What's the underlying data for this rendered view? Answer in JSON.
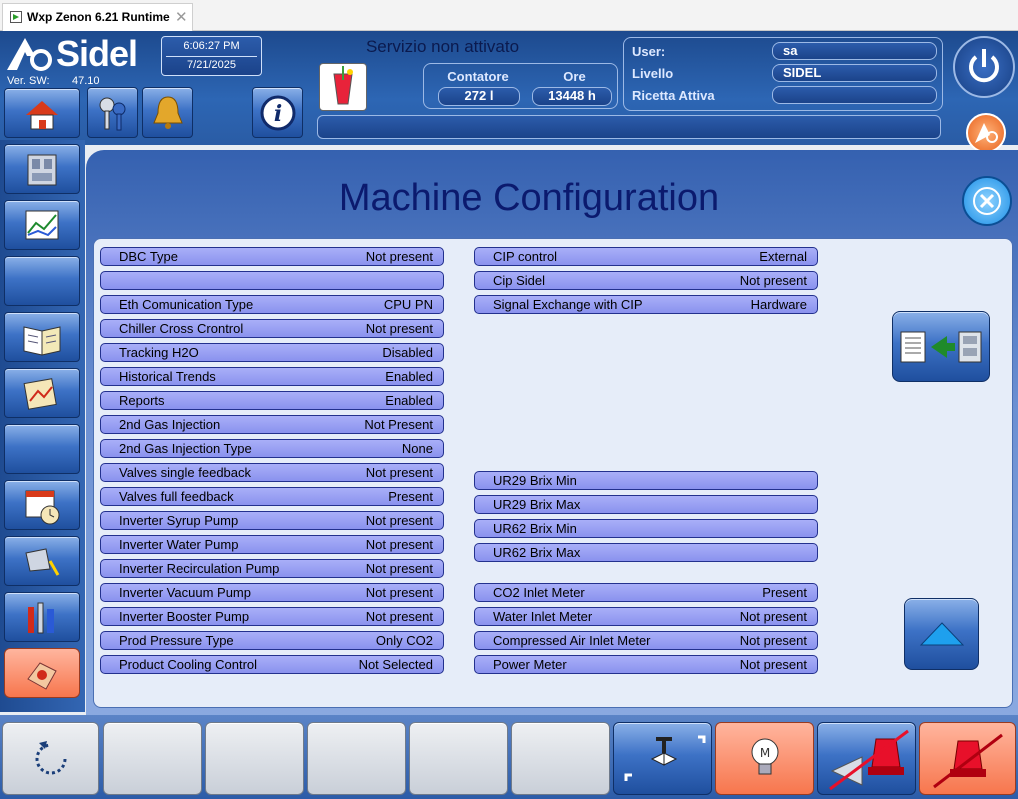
{
  "window": {
    "title": "Wxp Zenon 6.21 Runtime",
    "close": "✕"
  },
  "header": {
    "brand": "Sidel",
    "version_label": "Ver. SW:",
    "version_value": "47.10",
    "time": "6:06:27 PM",
    "date": "7/21/2025",
    "service_status": "Servizio non attivato",
    "counter_label": "Contatore",
    "counter_value": "272 l",
    "hours_label": "Ore",
    "hours_value": "13448 h",
    "user_label": "User:",
    "user_value": "sa",
    "level_label": "Livello",
    "level_value": "SIDEL",
    "recipe_label": "Ricetta Attiva",
    "recipe_value": ""
  },
  "page": {
    "title": "Machine Configuration"
  },
  "left_rows": [
    {
      "label": "DBC Type",
      "value": "Not present"
    },
    {
      "label": "",
      "value": ""
    },
    {
      "label": "Eth Comunication Type",
      "value": "CPU PN"
    },
    {
      "label": "Chiller Cross Crontrol",
      "value": "Not present"
    },
    {
      "label": "Tracking H2O",
      "value": "Disabled"
    },
    {
      "label": "Historical Trends",
      "value": "Enabled"
    },
    {
      "label": "Reports",
      "value": "Enabled"
    },
    {
      "label": "2nd Gas Injection",
      "value": "Not Present"
    },
    {
      "label": "2nd Gas Injection Type",
      "value": "None"
    },
    {
      "label": "Valves single feedback",
      "value": "Not present"
    },
    {
      "label": "Valves full feedback",
      "value": "Present"
    },
    {
      "label": "Inverter Syrup Pump",
      "value": "Not present"
    },
    {
      "label": "Inverter Water Pump",
      "value": "Not present"
    },
    {
      "label": "Inverter Recirculation Pump",
      "value": "Not present"
    },
    {
      "label": "Inverter Vacuum Pump",
      "value": "Not present"
    },
    {
      "label": "Inverter Booster Pump",
      "value": "Not present"
    },
    {
      "label": "Prod Pressure Type",
      "value": "Only CO2"
    },
    {
      "label": "Product Cooling Control",
      "value": "Not Selected"
    }
  ],
  "right_rows_top": [
    {
      "label": "CIP control",
      "value": "External"
    },
    {
      "label": "Cip Sidel",
      "value": "Not present"
    },
    {
      "label": "Signal Exchange with CIP",
      "value": "Hardware"
    }
  ],
  "right_rows_brix": [
    {
      "label": "UR29 Brix Min",
      "value": ""
    },
    {
      "label": "UR29 Brix Max",
      "value": ""
    },
    {
      "label": "UR62 Brix Min",
      "value": ""
    },
    {
      "label": "UR62 Brix Max",
      "value": ""
    }
  ],
  "right_rows_meters": [
    {
      "label": "CO2 Inlet Meter",
      "value": "Present"
    },
    {
      "label": "Water Inlet Meter",
      "value": "Not present"
    },
    {
      "label": "Compressed Air Inlet Meter",
      "value": "Not present"
    },
    {
      "label": "Power Meter",
      "value": "Not present"
    }
  ],
  "sidebar_icons": [
    "home-icon",
    "machine-icon",
    "trend-chart-icon",
    "blank",
    "manual-book-icon",
    "report-chart-icon",
    "blank",
    "calendar-clock-icon",
    "lamp-icon",
    "tools-icon",
    "hand-config-icon"
  ],
  "colors": {
    "accent": "#2d66b4",
    "row_fill": "#9aa0f2",
    "title": "#0b1a6e",
    "salmon": "#f7764d"
  }
}
